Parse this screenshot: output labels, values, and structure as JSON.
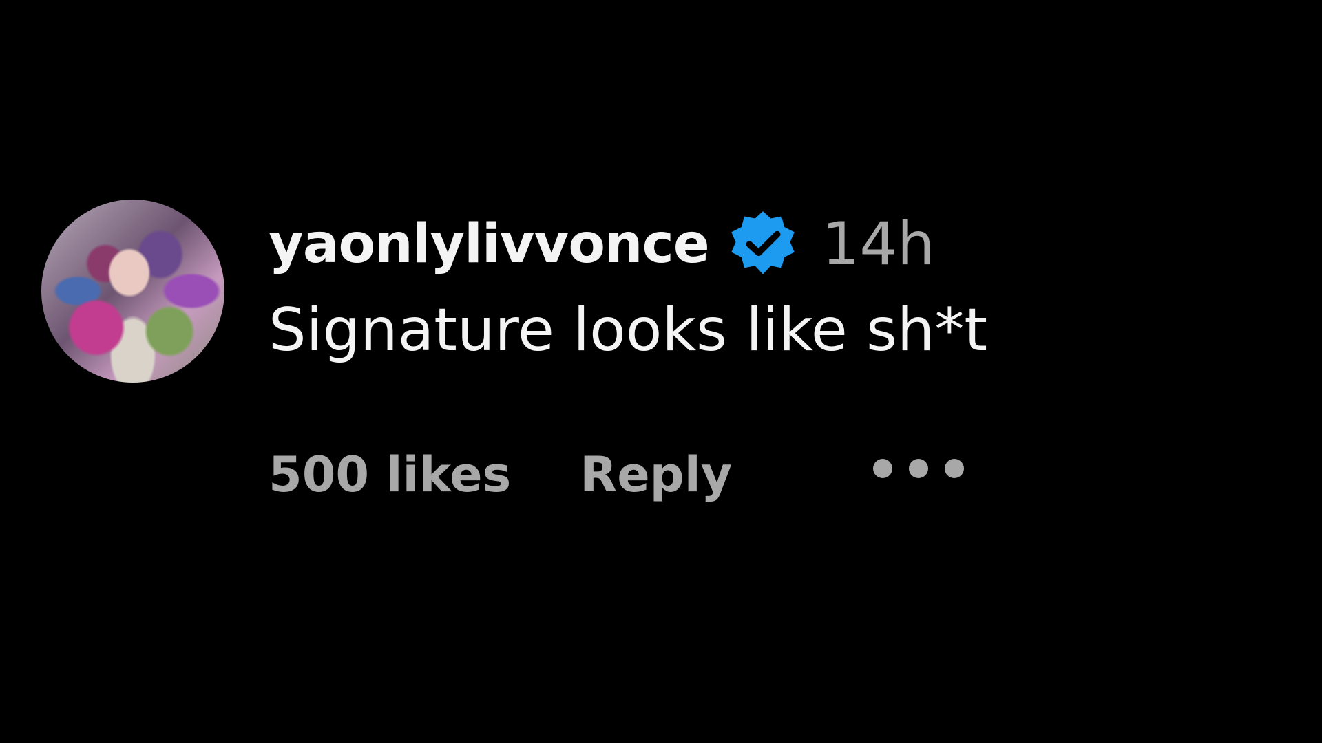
{
  "comment": {
    "username": "yaonlylivvonce",
    "timestamp": "14h",
    "text": "Signature looks like sh*t",
    "likes": "500 likes",
    "reply_label": "Reply",
    "verified_color": "#1d9bf0",
    "avatar_icon": "avatar-photo",
    "more_icon": "more-options-icon"
  }
}
